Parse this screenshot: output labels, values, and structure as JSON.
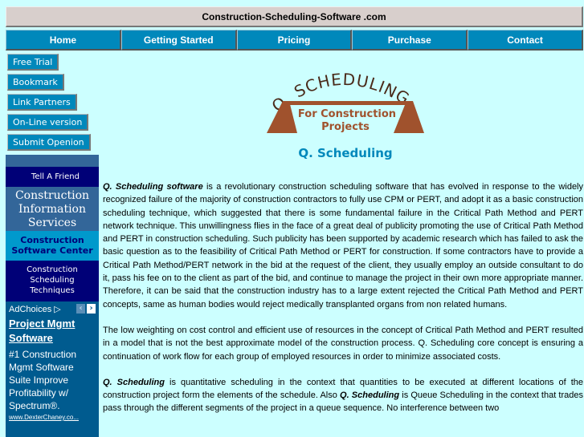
{
  "site_title": "Construction-Scheduling-Software .com",
  "topnav": [
    {
      "label": "Home"
    },
    {
      "label": "Getting Started"
    },
    {
      "label": "Pricing"
    },
    {
      "label": "Purchase"
    },
    {
      "label": "Contact"
    }
  ],
  "side_buttons": [
    {
      "label": "Free Trial"
    },
    {
      "label": "Bookmark"
    },
    {
      "label": "Link Partners"
    },
    {
      "label": "On-Line version"
    },
    {
      "label": "Submit Openion"
    }
  ],
  "sidebar": {
    "tell_friend": "Tell A Friend",
    "cis": [
      "Construction",
      "Information",
      "Services"
    ],
    "csc": [
      "Construction",
      "Software Center"
    ],
    "cst": [
      "Construction",
      "Scheduling",
      "Techniques"
    ]
  },
  "ad": {
    "choices": "AdChoices ▷",
    "prev": "‹",
    "next": "›",
    "title": "Project Mgmt Software",
    "body": "#1 Construction Mgmt Software Suite Improve Profitability w/ Spectrum®.",
    "url": "www.DexterChaney.co..."
  },
  "logo": {
    "arc_text": "Q. SCHEDULING",
    "line1": "For Construction",
    "line2": "Projects"
  },
  "heading": "Q. Scheduling",
  "paragraphs": [
    {
      "lead": "Q. Scheduling software",
      "text": " is a revolutionary construction scheduling software that has evolved in response to the widely recognized failure of the majority of construction contractors to fully use CPM or PERT, and adopt it as a basic construction scheduling technique, which suggested that there is some fundamental failure in the Critical Path Method and PERT network technique. This unwillingness flies in the face of a great deal of publicity promoting the use of Critical Path Method and PERT in construction scheduling. Such publicity has been supported by academic research which has failed to ask the basic question as to the feasibility of Critical Path Method or PERT for construction. If some contractors have to provide a Critical Path Method/PERT network in the bid at the request of the client, they usually employ an outside consultant to do it, pass his fee on to the client as part of the bid, and continue to manage the project in their own more appropriate manner. Therefore, it can be said that the construction industry has to a large extent rejected the Critical Path Method and PERT concepts, same as human bodies would reject medically transplanted organs from non related humans."
    },
    {
      "lead": "",
      "text": "The low weighting on cost control and efficient use of resources in the concept of Critical Path Method and PERT resulted in a model that is not the best approximate model of the construction process. Q. Scheduling core concept is ensuring a continuation of work flow for each group of employed resources in order to minimize associated costs."
    },
    {
      "lead": "Q. Scheduling",
      "text": " is quantitative scheduling in the context that quantities to be executed at different locations of the construction project form the elements of the schedule. Also ",
      "lead2": "Q. Scheduling",
      "text2": " is Queue Scheduling in the context that trades pass through the different segments of the project in a queue sequence. No interference between two"
    }
  ]
}
